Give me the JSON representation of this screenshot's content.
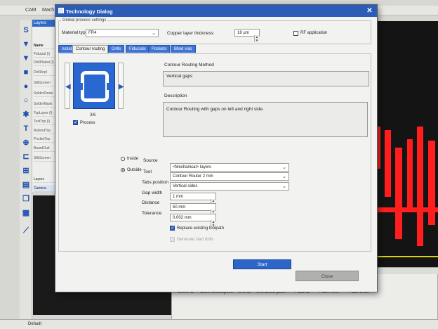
{
  "background": {
    "titlebar": {
      "app": "CAM",
      "doc": "Mach"
    },
    "layers_panel": {
      "header": "Layers",
      "name_header": "Name",
      "items": [
        "Fiducial (l)",
        "DrillPlated (l)",
        "DrillUnpl",
        "SilkScreen",
        "SolderPaste",
        "SolderMask",
        "TopLayer (l)",
        "TextTop (l)",
        "RuboutTop",
        "PocketTop",
        "BoardOutl",
        "SilkScreen"
      ],
      "bottom_tabs": [
        "Layers",
        "Camera"
      ]
    },
    "fault_monitor": {
      "title": "Fault monitor",
      "columns": [
        "Client ID",
        "Client Description",
        "Unit ID",
        "Unit Description",
        "Fault ID",
        "Fault Time",
        "Fault Code"
      ]
    },
    "status_bar": "Default"
  },
  "dialog": {
    "title": "Technology Dialog",
    "global_group_label": "Global process settings",
    "material_type_label": "Material type",
    "material_type_value": "FR4",
    "copper_thickness_label": "Copper layer thickness",
    "copper_thickness_value": "18 µm",
    "rf_application_label": "RF application",
    "tabs": [
      "Isolate",
      "Contour routing",
      "Drills",
      "Fiducials",
      "Pockets",
      "Blind vias"
    ],
    "active_tab": "Contour routing",
    "preview_counter": "3/6",
    "process_label": "Process",
    "routing_method_label": "Contour Routing Method",
    "routing_method_value": "Vertical gaps",
    "description_label": "Description",
    "description_value": "Contour Routing with gaps on left and right side.",
    "inside_label": "Inside",
    "outside_label": "Outside",
    "source_label": "Source",
    "source_value": "<Mechanical> layers",
    "tool_label": "Tool",
    "tool_value": "Contour Router 2 mm",
    "tabs_position_label": "Tabs position",
    "tabs_position_value": "Vertical sides",
    "gap_width_label": "Gap width",
    "gap_width_value": "1 mm",
    "distance_label": "Distance",
    "distance_value": "50 mm",
    "tolerance_label": "Tolerance",
    "tolerance_value": "0,002 mm",
    "replace_toolpath_label": "Replace existing toolpath",
    "generate_drills_label": "Generate start drills",
    "start_label": "Start",
    "close_label": "Close"
  }
}
